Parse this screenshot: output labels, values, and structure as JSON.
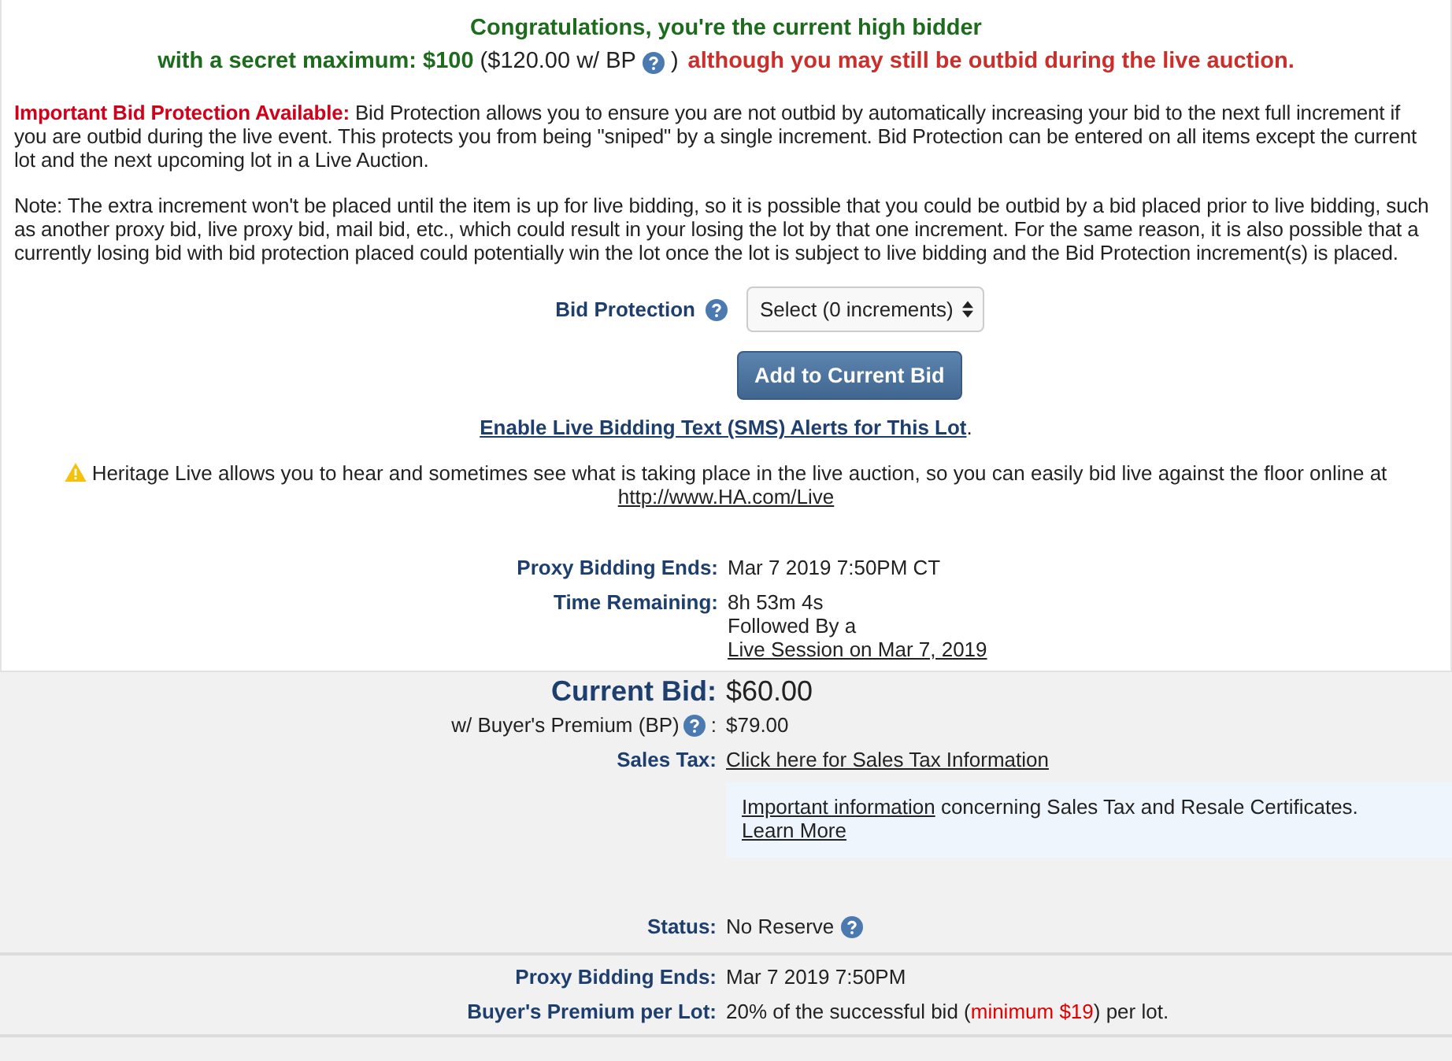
{
  "header": {
    "title": "Congratulations, you're the current high bidder",
    "maximum": "with a secret maximum: $100",
    "bp_amount": "($120.00 w/ BP",
    "bp_close": ")",
    "warning": "although you may still be outbid during the live auction."
  },
  "protection_text": "**Important Bid Protection Available:** Bid Protection allows you to ensure you are not outbid by automatically increasing your bid to the next full increment if you are outbid during the live event. This protects you from being \"sniped\" by a single increment. Bid Protection can be entered on all items except the current lot and the next upcoming lot in a Live Auction.",
  "note_text": "Note: The extra increment won't be placed until the item is up for live bidding, so it is possible that you could be outbid by a bid placed prior to live bidding, such as another proxy bid, live proxy bid, mail bid, etc., which could result in your losing the lot by that one increment. For the same reason, it is also possible that a currently losing bid with bid protection placed could potentially win the lot once the lot is subject to live bidding and the Bid Protection increment(s) is placed.",
  "bid_protection": {
    "label": "Bid Protection",
    "value": "Select (0 increments)"
  },
  "add_button": "Add to Current Bid",
  "sms": {
    "link": "Enable Live Bidding Text (SMS) Alerts for This Lot",
    "end": "."
  },
  "live_note": {
    "text": "Heritage Live allows you to hear and sometimes see what is taking place in the live auction, so you can easily bid live against the floor online at",
    "link": "http://www.HA.com/Live"
  },
  "timing": {
    "proxy_label": "Proxy Bidding Ends:",
    "proxy_value": "Mar 7 2019 7:50PM CT",
    "remaining_label": "Time Remaining:",
    "remaining_value": "8h 53m 4s",
    "followed": "Followed By a",
    "session_link": "Live Session on Mar 7, 2019"
  },
  "bid": {
    "current_label": "Current Bid:",
    "current_value": "$60.00",
    "bp_label": "w/ Buyer's Premium (BP)",
    "bp_colon": ":",
    "bp_value": "$79.00",
    "tax_label": "Sales Tax:",
    "tax_link": "Click here for Sales Tax Information",
    "info_link": "Important information",
    "info_text": "concerning Sales Tax and Resale Certificates.",
    "learn_more": "Learn More",
    "status_label": "Status:",
    "status_value": "No Reserve"
  },
  "footer": {
    "proxy_label": "Proxy Bidding Ends:",
    "proxy_value": "Mar 7 2019 7:50PM",
    "premium_label": "Buyer's Premium per Lot:",
    "premium_before": "20% of the successful bid (",
    "premium_highlight": "minimum $19",
    "premium_after": ") per lot."
  }
}
